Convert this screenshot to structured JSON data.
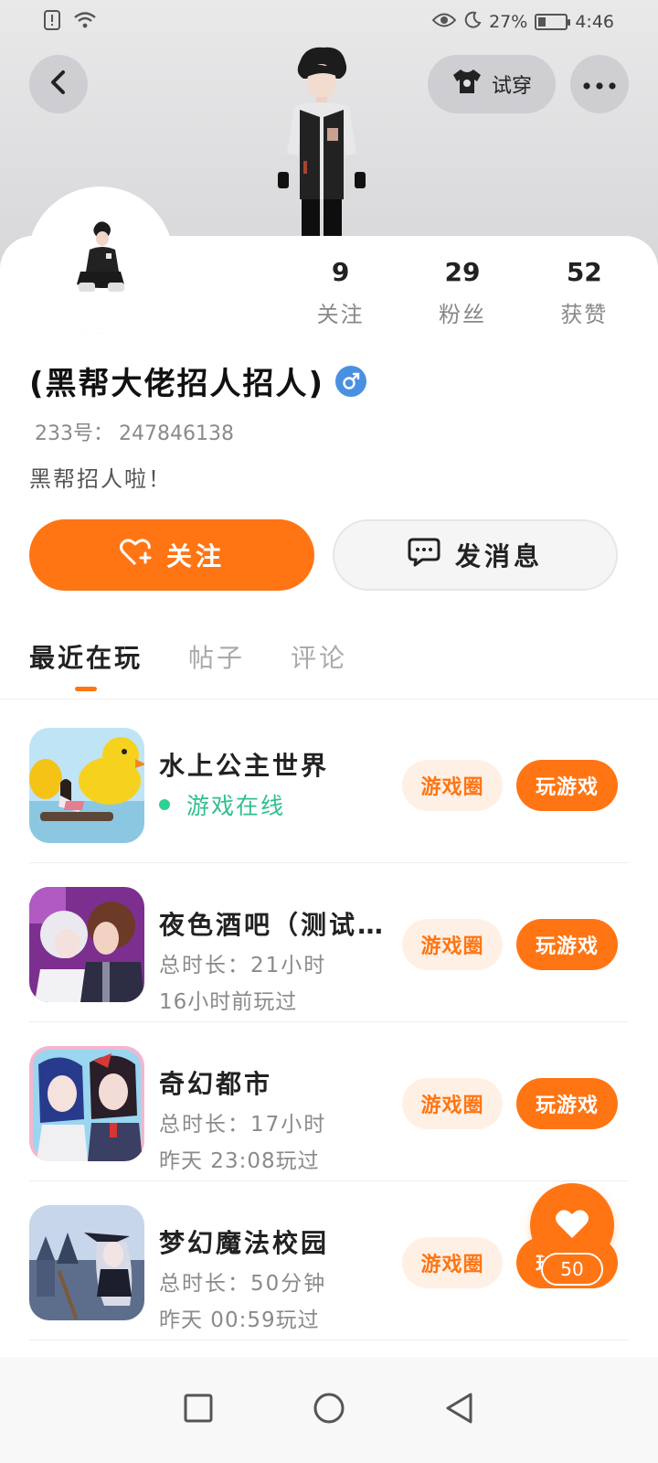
{
  "status_bar": {
    "battery": "27%",
    "time": "4:46"
  },
  "header": {
    "try_on_label": "试穿"
  },
  "profile": {
    "nickname": "(黑帮大佬招人招人)",
    "id_label": "233号：",
    "id_value": "247846138",
    "bio": "黑帮招人啦！",
    "stats": [
      {
        "num": "9",
        "label": "关注"
      },
      {
        "num": "29",
        "label": "粉丝"
      },
      {
        "num": "52",
        "label": "获赞"
      }
    ]
  },
  "actions": {
    "follow_label": "关注",
    "message_label": "发消息"
  },
  "tabs": [
    {
      "label": "最近在玩",
      "active": true
    },
    {
      "label": "帖子",
      "active": false
    },
    {
      "label": "评论",
      "active": false
    }
  ],
  "games": [
    {
      "title": "水上公主世界",
      "online": "游戏在线",
      "meta1": "",
      "meta2": "",
      "circle_label": "游戏圈",
      "play_label": "玩游戏"
    },
    {
      "title": "夜色酒吧（测试…",
      "online": "",
      "meta1": "总时长：21小时",
      "meta2": "16小时前玩过",
      "circle_label": "游戏圈",
      "play_label": "玩游戏"
    },
    {
      "title": "奇幻都市",
      "online": "",
      "meta1": "总时长：17小时",
      "meta2": "昨天 23:08玩过",
      "circle_label": "游戏圈",
      "play_label": "玩游戏"
    },
    {
      "title": "梦幻魔法校园",
      "online": "",
      "meta1": "总时长：50分钟",
      "meta2": "昨天 00:59玩过",
      "circle_label": "游戏圈",
      "play_label": "玩游戏"
    }
  ],
  "floating_like": {
    "count": "50"
  },
  "colors": {
    "accent": "#ff7514",
    "accent_light": "#fff0e5",
    "online_green": "#2fc08f",
    "gender_blue": "#4a90e2"
  }
}
